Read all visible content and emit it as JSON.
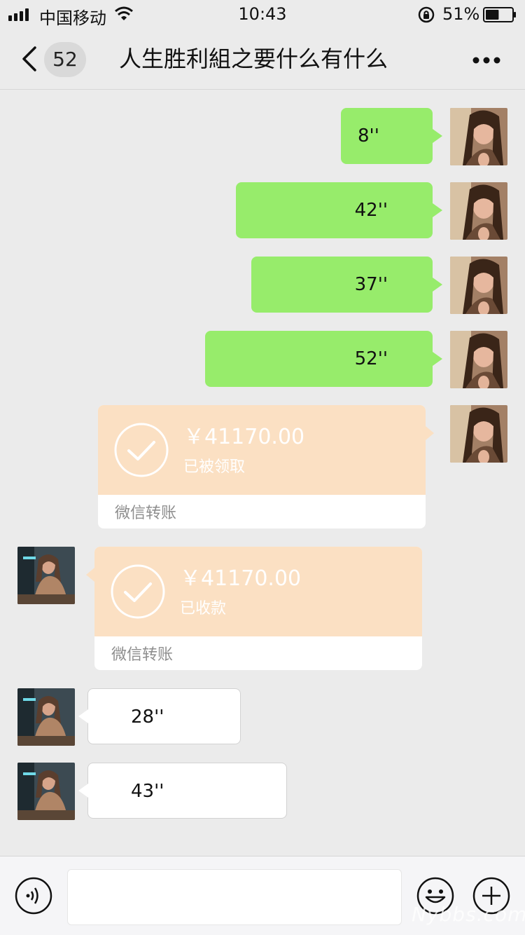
{
  "status_bar": {
    "carrier": "中国移动",
    "time": "10:43",
    "battery": "51%",
    "battery_level": 0.51
  },
  "nav": {
    "unread_count": "52",
    "title": "人生胜利組之要什么有什么"
  },
  "messages": [
    {
      "side": "out",
      "kind": "voice",
      "duration": "8''"
    },
    {
      "side": "out",
      "kind": "voice",
      "duration": "42''"
    },
    {
      "side": "out",
      "kind": "voice",
      "duration": "37''"
    },
    {
      "side": "out",
      "kind": "voice",
      "duration": "52''"
    },
    {
      "side": "out",
      "kind": "transfer",
      "amount": "￥41170.00",
      "status": "已被领取",
      "footer": "微信转账"
    },
    {
      "side": "in",
      "kind": "transfer",
      "amount": "￥41170.00",
      "status": "已收款",
      "footer": "微信转账"
    },
    {
      "side": "in",
      "kind": "voice",
      "duration": "28''"
    },
    {
      "side": "in",
      "kind": "voice",
      "duration": "43''"
    }
  ],
  "input": {
    "value": "",
    "placeholder": ""
  },
  "icons": {
    "back": "chevron-left-icon",
    "more": "more-dots-icon",
    "voice": "voice-icon",
    "emoji": "smile-icon",
    "plus": "plus-icon"
  },
  "colors": {
    "outgoing_bubble": "#97ec6b",
    "incoming_bubble": "#ffffff",
    "transfer_card": "#fbe0c3",
    "background": "#ebebeb"
  },
  "watermark": "Nybbs.com"
}
